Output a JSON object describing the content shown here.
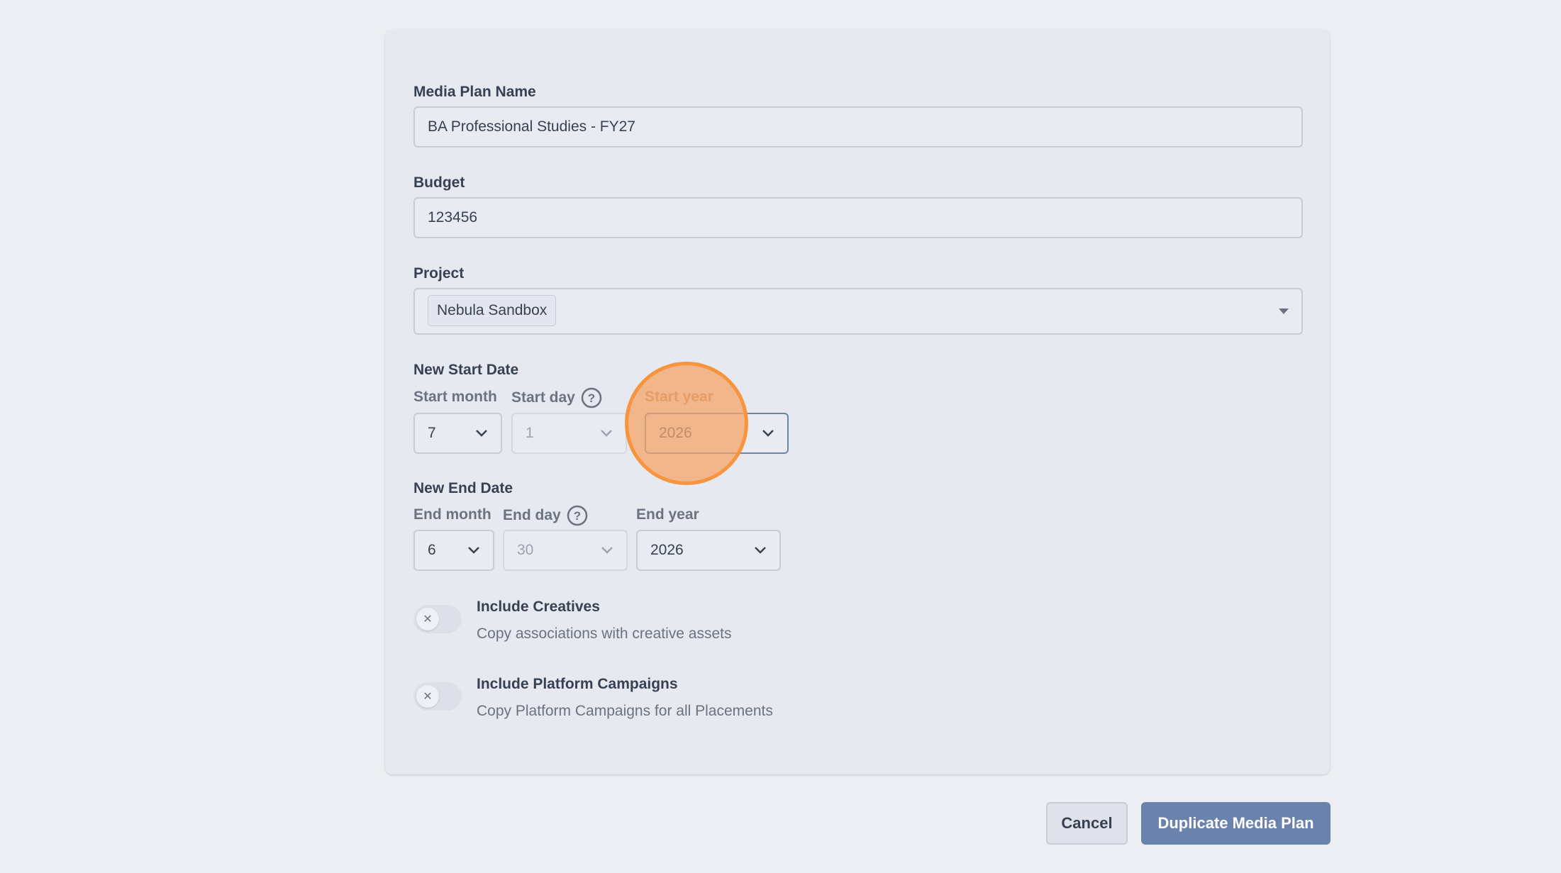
{
  "form": {
    "media_plan_name": {
      "label": "Media Plan Name",
      "value": "BA Professional Studies - FY27"
    },
    "budget": {
      "label": "Budget",
      "value": "123456"
    },
    "project": {
      "label": "Project",
      "selected_tag": "Nebula Sandbox"
    },
    "start_date": {
      "label": "New Start Date",
      "month_label": "Start month",
      "month_value": "7",
      "day_label": "Start day",
      "day_value": "1",
      "year_label": "Start year",
      "year_value": "2026"
    },
    "end_date": {
      "label": "New End Date",
      "month_label": "End month",
      "month_value": "6",
      "day_label": "End day",
      "day_value": "30",
      "year_label": "End year",
      "year_value": "2026"
    },
    "include_creatives": {
      "title": "Include Creatives",
      "description": "Copy associations with creative assets",
      "enabled": false
    },
    "include_platform_campaigns": {
      "title": "Include Platform Campaigns",
      "description": "Copy Platform Campaigns for all Placements",
      "enabled": false
    }
  },
  "actions": {
    "cancel_label": "Cancel",
    "submit_label": "Duplicate Media Plan"
  },
  "icons": {
    "help": "question-circle-icon",
    "chevron": "chevron-down-icon",
    "toggle_off": "x-icon"
  },
  "colors": {
    "primary_button": "#6b82ad",
    "highlight": "#f4a468"
  }
}
